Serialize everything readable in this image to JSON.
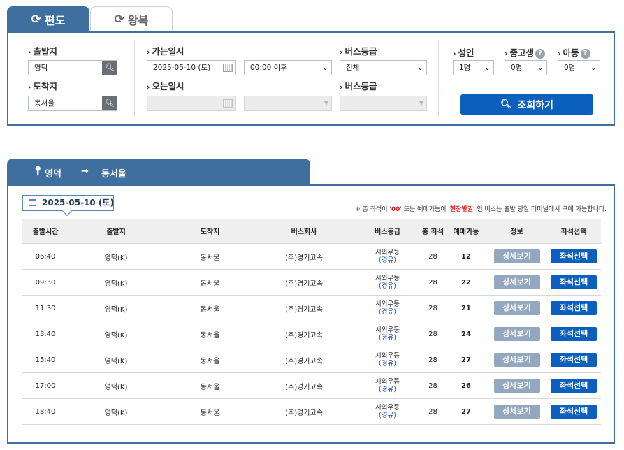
{
  "tabs": {
    "oneway": {
      "icon": "refresh-icon",
      "label": "편도"
    },
    "round": {
      "icon": "refresh-icon",
      "label": "왕복"
    }
  },
  "search": {
    "departure": {
      "label": "출발지",
      "value": "영덕"
    },
    "arrival": {
      "label": "도착지",
      "value": "동서울"
    },
    "go_date": {
      "label": "가는일시",
      "value": "2025-05-10 (토)",
      "time_value": "00:00 이후"
    },
    "return_date": {
      "label": "오는일시",
      "value": "",
      "time_value": ""
    },
    "bus_grade": {
      "label": "버스등급",
      "value": "전체"
    },
    "bus_grade_return": {
      "label": "버스등급",
      "value": ""
    },
    "adult": {
      "label": "성인",
      "value": "1명"
    },
    "student": {
      "label": "중고생",
      "value": "0명",
      "help": "?"
    },
    "child": {
      "label": "아동",
      "value": "0명",
      "help": "?"
    },
    "submit_label": "조회하기"
  },
  "route": {
    "from": "영덕",
    "arrow": "→",
    "to": "동서울"
  },
  "results": {
    "date": "2025-05-10 (토)",
    "notice": {
      "pre": "※ 총 좌석이 '",
      "zero": "00",
      "mid": "' 또는 예매가능이 '",
      "onsite": "현장발권",
      "post": "' 인 버스는 출발 당일 터미널에서 구매 가능합니다."
    },
    "columns": [
      "출발시간",
      "출발지",
      "도착지",
      "버스회사",
      "버스등급",
      "총 좌석",
      "예매가능",
      "정보",
      "좌석선택"
    ],
    "rows": [
      {
        "time": "06:40",
        "from": "영덕(K)",
        "to": "동서울",
        "company": "(주)경기고속",
        "grade": "시외우등",
        "grade_sub": "(경유)",
        "total": "28",
        "available": "12",
        "detail": "상세보기",
        "seat": "좌석선택"
      },
      {
        "time": "09:30",
        "from": "영덕(K)",
        "to": "동서울",
        "company": "(주)경기고속",
        "grade": "시외우등",
        "grade_sub": "(경유)",
        "total": "28",
        "available": "22",
        "detail": "상세보기",
        "seat": "좌석선택"
      },
      {
        "time": "11:30",
        "from": "영덕(K)",
        "to": "동서울",
        "company": "(주)경기고속",
        "grade": "시외우등",
        "grade_sub": "(경유)",
        "total": "28",
        "available": "21",
        "detail": "상세보기",
        "seat": "좌석선택"
      },
      {
        "time": "13:40",
        "from": "영덕(K)",
        "to": "동서울",
        "company": "(주)경기고속",
        "grade": "시외우등",
        "grade_sub": "(경유)",
        "total": "28",
        "available": "24",
        "detail": "상세보기",
        "seat": "좌석선택"
      },
      {
        "time": "15:40",
        "from": "영덕(K)",
        "to": "동서울",
        "company": "(주)경기고속",
        "grade": "시외우등",
        "grade_sub": "(경유)",
        "total": "28",
        "available": "27",
        "detail": "상세보기",
        "seat": "좌석선택"
      },
      {
        "time": "17:00",
        "from": "영덕(K)",
        "to": "동서울",
        "company": "(주)경기고속",
        "grade": "시외우등",
        "grade_sub": "(경유)",
        "total": "28",
        "available": "26",
        "detail": "상세보기",
        "seat": "좌석선택"
      },
      {
        "time": "18:40",
        "from": "영덕(K)",
        "to": "동서울",
        "company": "(주)경기고속",
        "grade": "시외우등",
        "grade_sub": "(경유)",
        "total": "28",
        "available": "27",
        "detail": "상세보기",
        "seat": "좌석선택"
      }
    ]
  }
}
